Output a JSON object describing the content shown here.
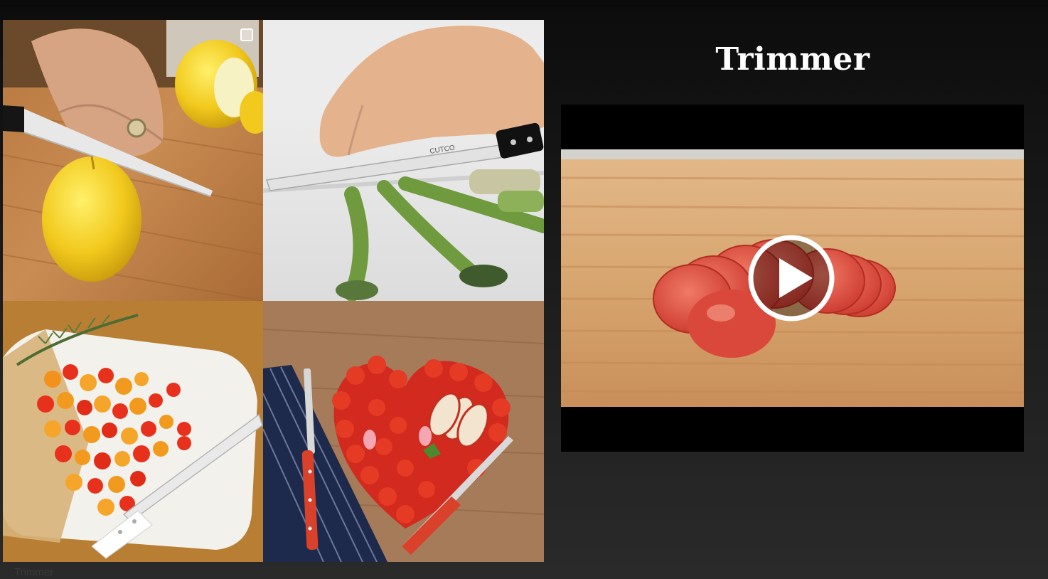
{
  "slide": {
    "title": "Trimmer",
    "footer_caption": "Trimmer"
  },
  "gallery": {
    "photos": [
      {
        "subject": "lemon-cutting"
      },
      {
        "subject": "asparagus-slicing"
      },
      {
        "subject": "cherry-tomatoes-board"
      },
      {
        "subject": "fruit-heart"
      }
    ],
    "knife_brand": "CUTCO"
  },
  "video": {
    "play_icon": "play-icon"
  },
  "colors": {
    "background": "#1b1b1b",
    "title": "#ffffff",
    "knife_red": "#d9412b"
  }
}
